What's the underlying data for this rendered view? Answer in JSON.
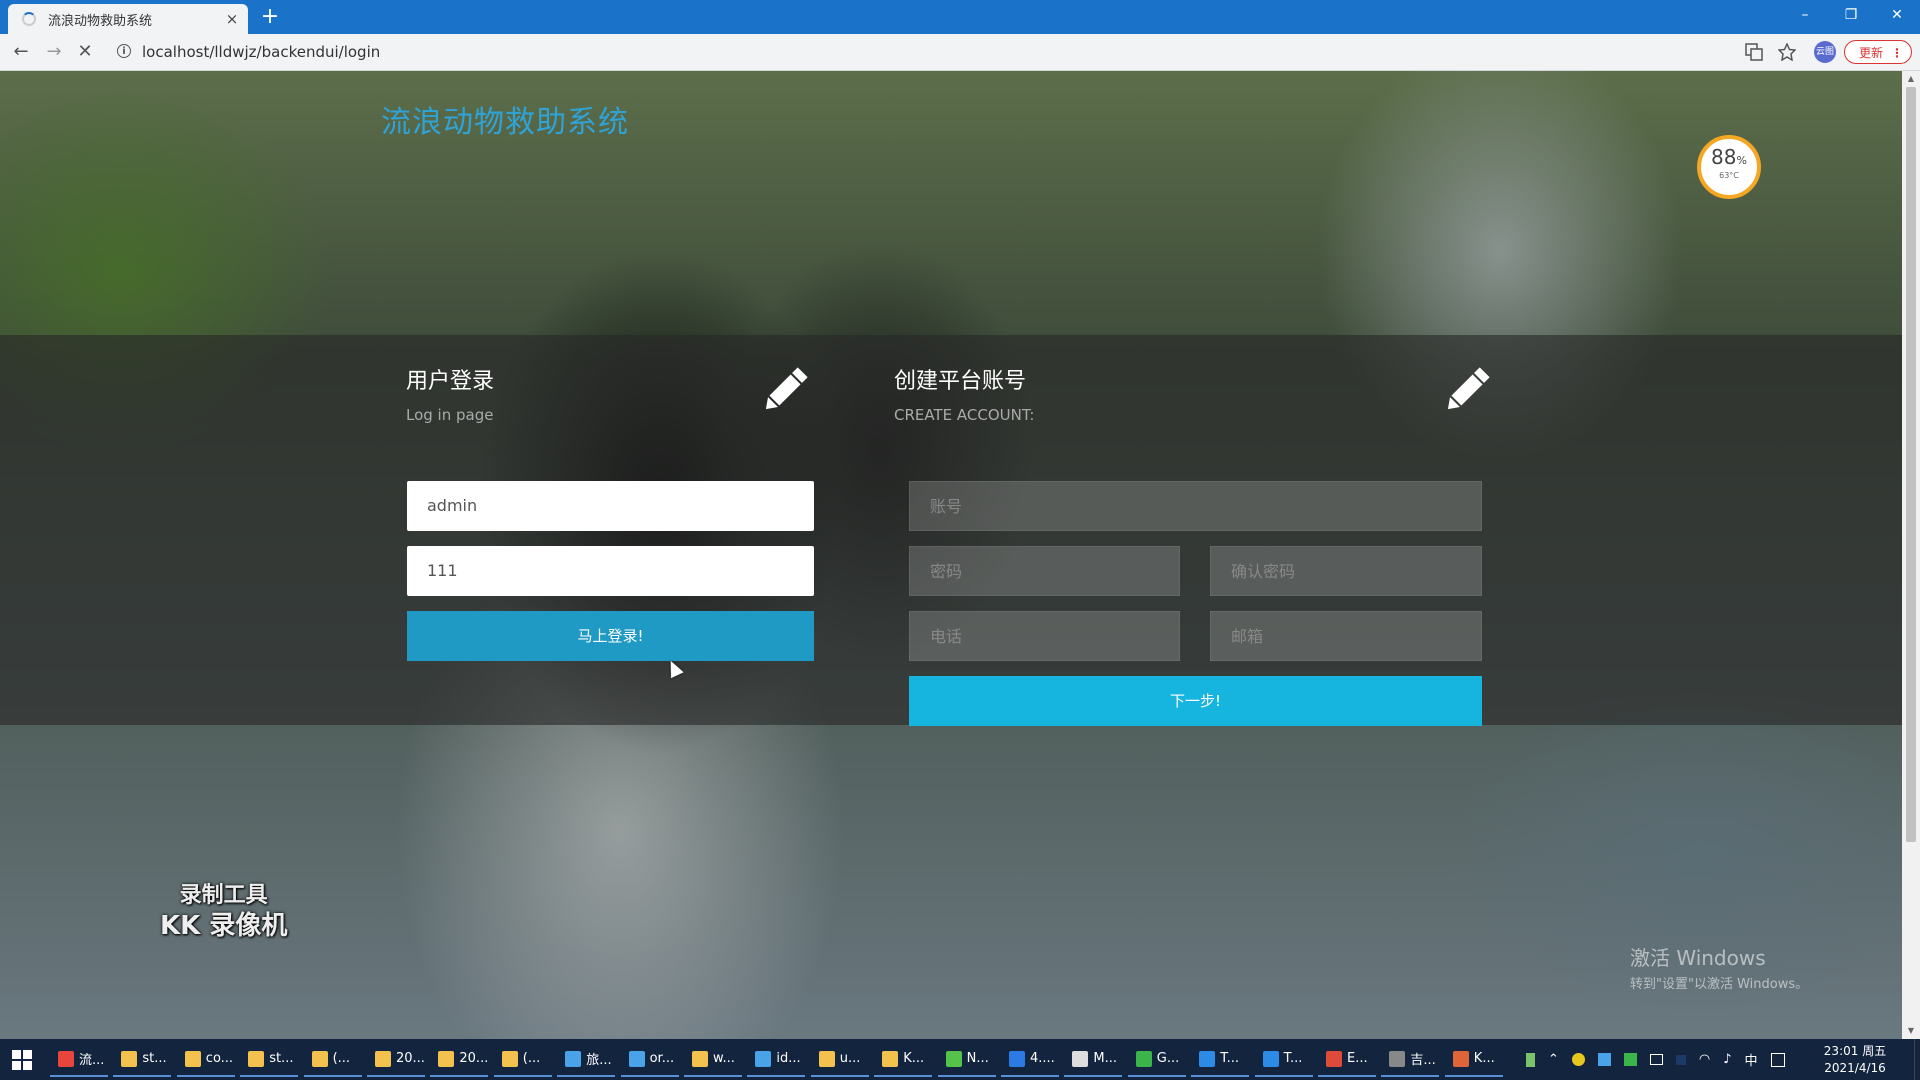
{
  "browser": {
    "tab_title": "流浪动物救助系统",
    "tab_close": "×",
    "new_tab": "+",
    "url": "localhost/lldwjz/backendui/login",
    "info_icon": "i",
    "profile_label": "云图",
    "update_label": "更新",
    "update_menu": "⋮",
    "nav": {
      "back": "←",
      "forward": "→",
      "reload": "✕"
    },
    "window_controls": {
      "minimize": "–",
      "restore": "❐",
      "close": "✕"
    }
  },
  "site": {
    "title": "流浪动物救助系统"
  },
  "gauge": {
    "percent": "88",
    "percent_unit": "%",
    "temp": "63°C"
  },
  "login": {
    "title": "用户登录",
    "subtitle": "Log in page",
    "username_value": "admin",
    "password_value": "111",
    "submit_label": "马上登录!"
  },
  "register": {
    "title": "创建平台账号",
    "subtitle": "CREATE ACCOUNT:",
    "account_placeholder": "账号",
    "password_placeholder": "密码",
    "confirm_placeholder": "确认密码",
    "phone_placeholder": "电话",
    "email_placeholder": "邮箱",
    "next_label": "下一步!"
  },
  "watermark": {
    "line1": "录制工具",
    "line2": "KK 录像机"
  },
  "activation": {
    "line1": "激活 Windows",
    "line2": "转到\"设置\"以激活 Windows。"
  },
  "taskbar": {
    "items": [
      {
        "label": "流...",
        "color": "#e8453c"
      },
      {
        "label": "st...",
        "color": "#f2c14e"
      },
      {
        "label": "co...",
        "color": "#f2c14e"
      },
      {
        "label": "st...",
        "color": "#f2c14e"
      },
      {
        "label": "(...",
        "color": "#f2c14e"
      },
      {
        "label": "20...",
        "color": "#f2c14e"
      },
      {
        "label": "20...",
        "color": "#f2c14e"
      },
      {
        "label": "(...",
        "color": "#f2c14e"
      },
      {
        "label": "旅...",
        "color": "#4aa3e8"
      },
      {
        "label": "or...",
        "color": "#4aa3e8"
      },
      {
        "label": "w...",
        "color": "#f2c14e"
      },
      {
        "label": "id...",
        "color": "#4aa3e8"
      },
      {
        "label": "u...",
        "color": "#f2c14e"
      },
      {
        "label": "K...",
        "color": "#f2c14e"
      },
      {
        "label": "N...",
        "color": "#55c24a"
      },
      {
        "label": "4....",
        "color": "#2c7be5"
      },
      {
        "label": "M...",
        "color": "#dddddd"
      },
      {
        "label": "G...",
        "color": "#3bb54a"
      },
      {
        "label": "T...",
        "color": "#2c8be5"
      },
      {
        "label": "T...",
        "color": "#2c8be5"
      },
      {
        "label": "E...",
        "color": "#e04a3a"
      },
      {
        "label": "吉...",
        "color": "#888888"
      },
      {
        "label": "K...",
        "color": "#e0643a"
      }
    ],
    "tray_ime": "中",
    "time": "23:01 周五",
    "date": "2021/4/16"
  }
}
